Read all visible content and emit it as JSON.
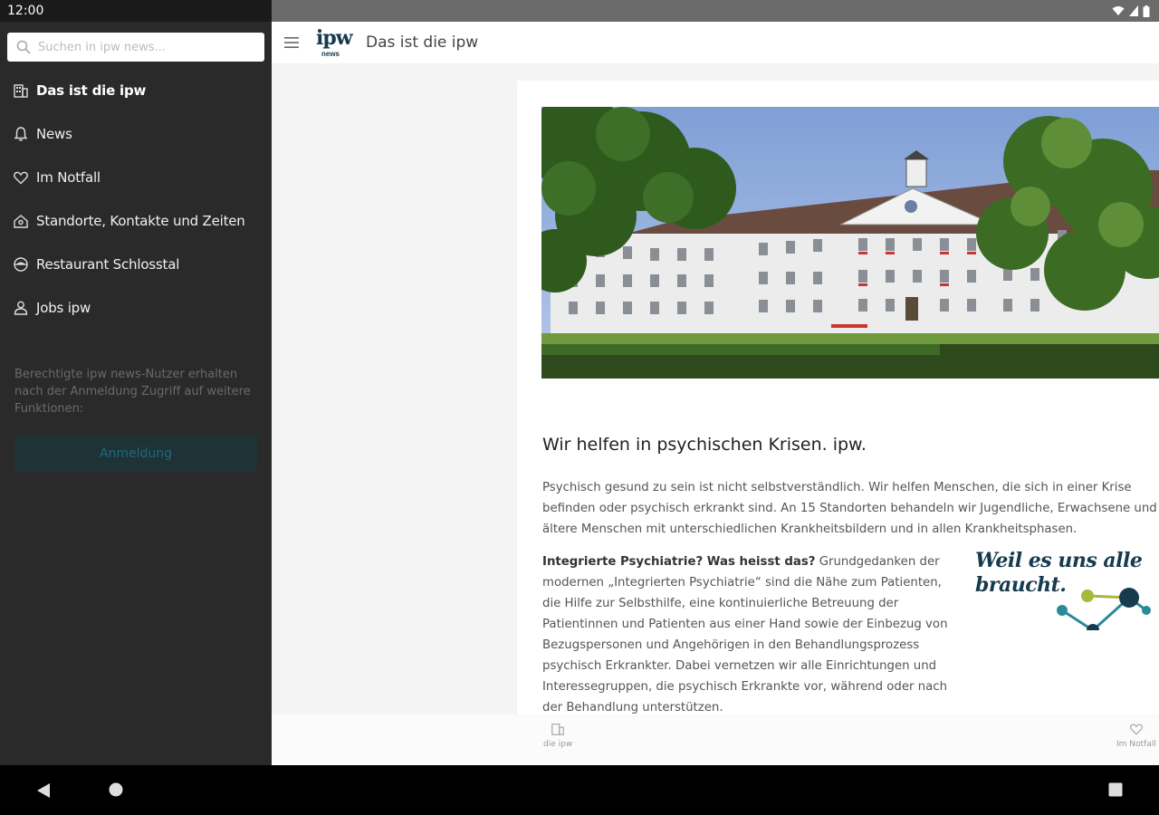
{
  "status_bar": {
    "time": "12:00"
  },
  "search": {
    "placeholder": "Suchen in ipw news..."
  },
  "nav": {
    "items": [
      {
        "label": "Das ist die ipw",
        "icon": "building-icon"
      },
      {
        "label": "News",
        "icon": "bell-icon"
      },
      {
        "label": "Im Notfall",
        "icon": "heart-icon"
      },
      {
        "label": "Standorte, Kontakte und Zeiten",
        "icon": "location-icon"
      },
      {
        "label": "Restaurant Schlosstal",
        "icon": "restaurant-icon"
      },
      {
        "label": "Jobs ipw",
        "icon": "person-icon"
      }
    ]
  },
  "drawer": {
    "note": "Berechtigte ipw news-Nutzer erhalten nach der Anmeldung Zugriff auf weitere Funktionen:",
    "login_label": "Anmeldung"
  },
  "appbar": {
    "logo_text": "ipw",
    "logo_sub": "news",
    "title": "Das ist die ipw"
  },
  "article": {
    "headline": "Wir helfen in psychischen Krisen. ipw.",
    "intro": "Psychisch gesund zu sein ist nicht selbstverständlich. Wir helfen Menschen, die sich in einer Krise befinden oder psychisch erkrankt sind. An 15 Standorten behandeln wir Jugendliche, Erwachsene und ältere Menschen mit unterschiedlichen Krankheitsbildern und in allen Krankheitsphasen.",
    "section_title": "Integrierte Psychiatrie? Was heisst das?",
    "section_body": "Grundgedanken der modernen „Integrierten Psychiatrie“ sind die Nähe zum Patienten, die Hilfe zur Selbsthilfe, eine kontinuierliche Betreuung der Patientinnen und Patienten aus einer Hand sowie der Einbezug von Bezugspersonen und Angehörigen in den Behandlungsprozess psychisch Erkrankter. Dabei vernetzen wir alle Einrichtungen und Interessegruppen, die psychisch Erkrankte vor, während oder nach der Behandlung unterstützen.",
    "slogan_line1": "Weil es uns alle",
    "slogan_line2": "braucht."
  },
  "bottom_nav": {
    "items": [
      {
        "label": "die ipw",
        "icon": "building-icon"
      },
      {
        "label": "Im Notfall",
        "icon": "heart-icon"
      }
    ]
  },
  "colors": {
    "drawer_bg": "#2a2a2a",
    "brand": "#163a4e",
    "accent_green": "#a8b83a",
    "accent_teal": "#2a8a9a"
  }
}
